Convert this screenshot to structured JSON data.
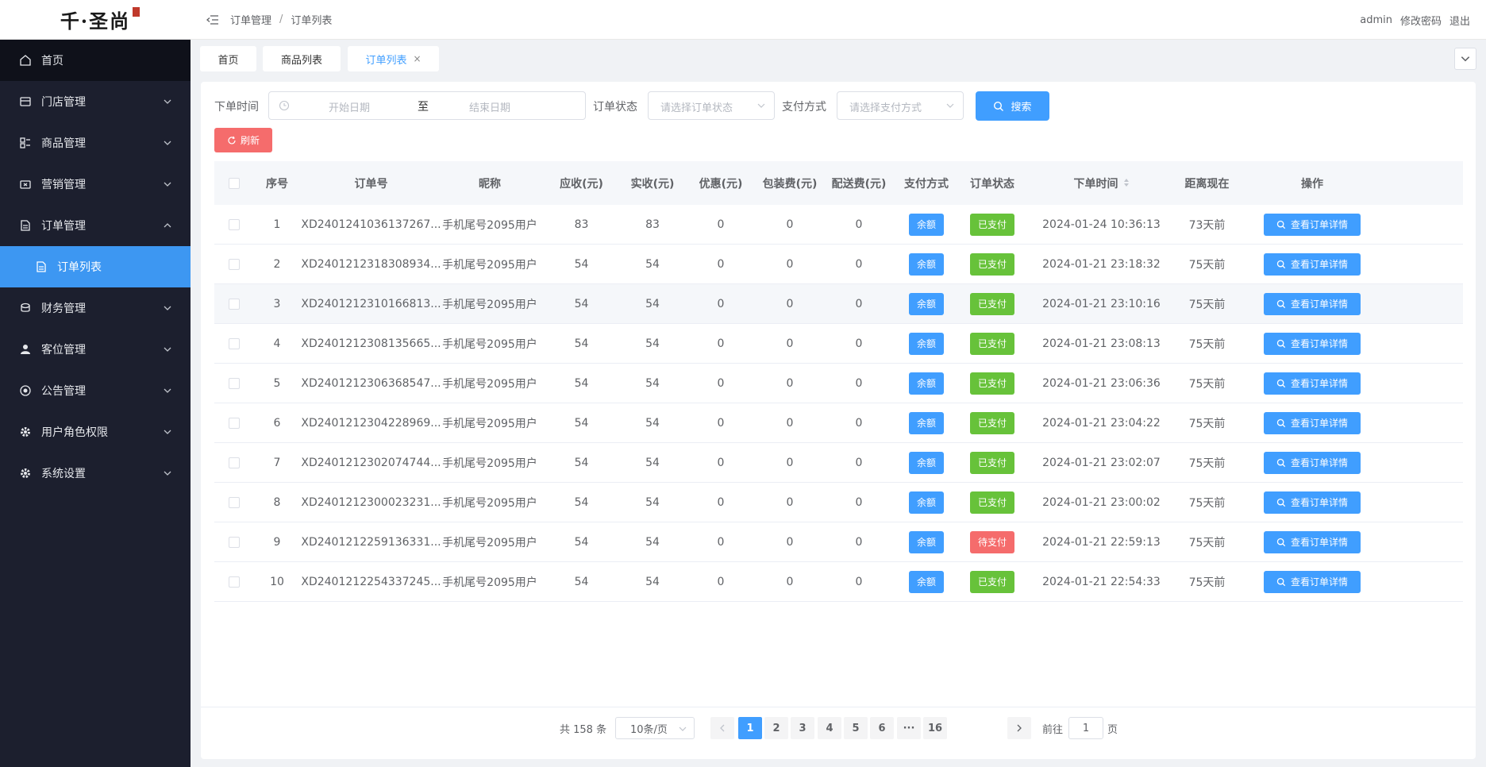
{
  "logo": {
    "text": "千·圣尚"
  },
  "sidebar": {
    "items": [
      {
        "label": "首页",
        "icon": "home-icon"
      },
      {
        "label": "门店管理",
        "icon": "store-icon"
      },
      {
        "label": "商品管理",
        "icon": "goods-icon"
      },
      {
        "label": "营销管理",
        "icon": "marketing-icon"
      },
      {
        "label": "订单管理",
        "icon": "order-icon"
      },
      {
        "label": "订单列表",
        "icon": "document-icon"
      },
      {
        "label": "财务管理",
        "icon": "finance-icon"
      },
      {
        "label": "客位管理",
        "icon": "user-icon"
      },
      {
        "label": "公告管理",
        "icon": "notice-icon"
      },
      {
        "label": "用户角色权限",
        "icon": "gear-icon"
      },
      {
        "label": "系统设置",
        "icon": "gear-icon"
      }
    ]
  },
  "header": {
    "breadcrumb": [
      "订单管理",
      "订单列表"
    ],
    "breadcrumb_sep": "/",
    "user": "admin",
    "change_password": "修改密码",
    "logout": "退出"
  },
  "tabs": [
    {
      "label": "首页"
    },
    {
      "label": "商品列表"
    },
    {
      "label": "订单列表",
      "close": "×"
    }
  ],
  "filters": {
    "order_time_label": "下单时间",
    "start_placeholder": "开始日期",
    "range_sep": "至",
    "end_placeholder": "结束日期",
    "status_label": "订单状态",
    "status_placeholder": "请选择订单状态",
    "pay_label": "支付方式",
    "pay_placeholder": "请选择支付方式",
    "search_button": "搜索",
    "refresh_button": "刷新"
  },
  "table": {
    "columns": [
      "序号",
      "订单号",
      "昵称",
      "应收(元)",
      "实收(元)",
      "优惠(元)",
      "包装费(元)",
      "配送费(元)",
      "支付方式",
      "订单状态",
      "下单时间",
      "距离现在",
      "操作"
    ],
    "detail_button": "查看订单详情",
    "rows": [
      {
        "no": "1",
        "order_no": "XD2401241036137267...",
        "nickname": "手机尾号2095用户",
        "receivable": "83",
        "received": "83",
        "discount": "0",
        "packing": "0",
        "delivery": "0",
        "pay": "余额",
        "status": "已支付",
        "time": "2024-01-24 10:36:13",
        "ago": "73天前"
      },
      {
        "no": "2",
        "order_no": "XD2401212318308934...",
        "nickname": "手机尾号2095用户",
        "receivable": "54",
        "received": "54",
        "discount": "0",
        "packing": "0",
        "delivery": "0",
        "pay": "余额",
        "status": "已支付",
        "time": "2024-01-21 23:18:32",
        "ago": "75天前"
      },
      {
        "no": "3",
        "order_no": "XD2401212310166813...",
        "nickname": "手机尾号2095用户",
        "receivable": "54",
        "received": "54",
        "discount": "0",
        "packing": "0",
        "delivery": "0",
        "pay": "余额",
        "status": "已支付",
        "time": "2024-01-21 23:10:16",
        "ago": "75天前"
      },
      {
        "no": "4",
        "order_no": "XD2401212308135665...",
        "nickname": "手机尾号2095用户",
        "receivable": "54",
        "received": "54",
        "discount": "0",
        "packing": "0",
        "delivery": "0",
        "pay": "余额",
        "status": "已支付",
        "time": "2024-01-21 23:08:13",
        "ago": "75天前"
      },
      {
        "no": "5",
        "order_no": "XD2401212306368547...",
        "nickname": "手机尾号2095用户",
        "receivable": "54",
        "received": "54",
        "discount": "0",
        "packing": "0",
        "delivery": "0",
        "pay": "余额",
        "status": "已支付",
        "time": "2024-01-21 23:06:36",
        "ago": "75天前"
      },
      {
        "no": "6",
        "order_no": "XD2401212304228969...",
        "nickname": "手机尾号2095用户",
        "receivable": "54",
        "received": "54",
        "discount": "0",
        "packing": "0",
        "delivery": "0",
        "pay": "余额",
        "status": "已支付",
        "time": "2024-01-21 23:04:22",
        "ago": "75天前"
      },
      {
        "no": "7",
        "order_no": "XD2401212302074744...",
        "nickname": "手机尾号2095用户",
        "receivable": "54",
        "received": "54",
        "discount": "0",
        "packing": "0",
        "delivery": "0",
        "pay": "余额",
        "status": "已支付",
        "time": "2024-01-21 23:02:07",
        "ago": "75天前"
      },
      {
        "no": "8",
        "order_no": "XD2401212300023231...",
        "nickname": "手机尾号2095用户",
        "receivable": "54",
        "received": "54",
        "discount": "0",
        "packing": "0",
        "delivery": "0",
        "pay": "余额",
        "status": "已支付",
        "time": "2024-01-21 23:00:02",
        "ago": "75天前"
      },
      {
        "no": "9",
        "order_no": "XD2401212259136331...",
        "nickname": "手机尾号2095用户",
        "receivable": "54",
        "received": "54",
        "discount": "0",
        "packing": "0",
        "delivery": "0",
        "pay": "余额",
        "status": "待支付",
        "time": "2024-01-21 22:59:13",
        "ago": "75天前"
      },
      {
        "no": "10",
        "order_no": "XD2401212254337245...",
        "nickname": "手机尾号2095用户",
        "receivable": "54",
        "received": "54",
        "discount": "0",
        "packing": "0",
        "delivery": "0",
        "pay": "余额",
        "status": "已支付",
        "time": "2024-01-21 22:54:33",
        "ago": "75天前"
      }
    ]
  },
  "pagination": {
    "total": "共 158 条",
    "page_size": "10条/页",
    "pages": [
      "1",
      "2",
      "3",
      "4",
      "5",
      "6",
      "···",
      "16"
    ],
    "current_page": "1",
    "goto_prefix": "前往",
    "goto_value": "1",
    "goto_suffix": "页"
  },
  "colors": {
    "primary": "#409eff",
    "success": "#67c23a",
    "danger": "#f56c6c",
    "sidebar_bg": "#1c1f2e",
    "sidebar_active": "#3d97f2"
  }
}
